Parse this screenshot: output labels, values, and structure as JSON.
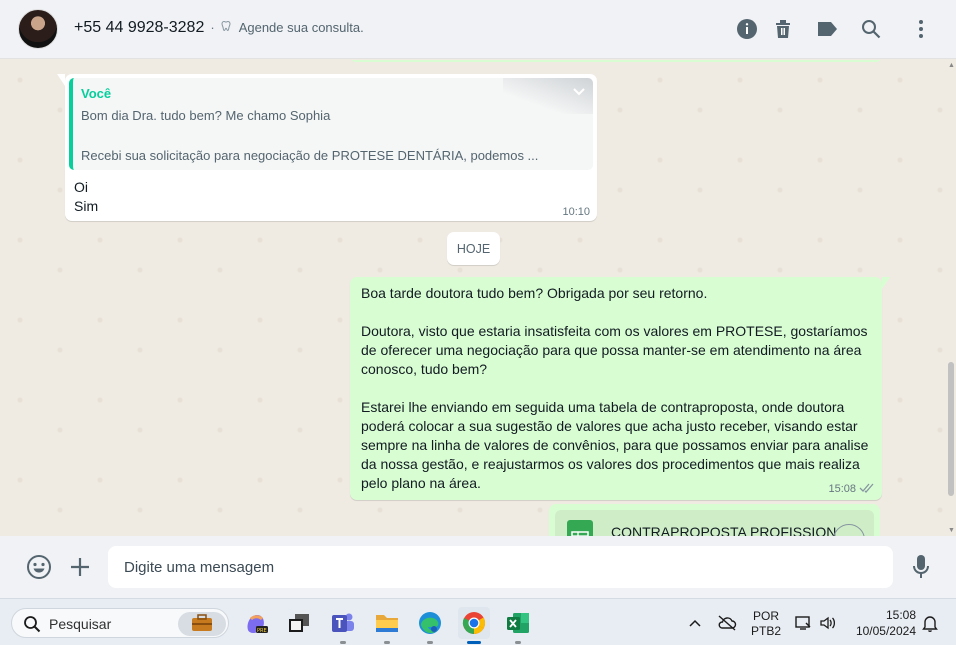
{
  "header": {
    "contact_name": "+55 44 9928-3282",
    "separator": "·",
    "status": "Agende sua consulta.",
    "icons": [
      "info-icon",
      "delete-icon",
      "label-icon",
      "search-icon",
      "menu-icon"
    ]
  },
  "chat": {
    "incoming": {
      "quote_author": "Você",
      "quote_line1": "Bom dia Dra. tudo bem? Me chamo Sophia",
      "quote_line2": "Recebi sua solicitação para negociação de PROTESE DENTÁRIA, podemos ...",
      "line1": "Oi",
      "line2": "Sim",
      "time": "10:10"
    },
    "day_divider": "HOJE",
    "outgoing": {
      "p1": "Boa tarde doutora tudo bem? Obrigada por seu retorno.",
      "p2": "Doutora, visto que estaria insatisfeita com os valores em PROTESE, gostaríamos de oferecer uma negociação para que possa manter-se em atendimento na área conosco, tudo bem?",
      "p3": "Estarei lhe enviando em seguida uma tabela de contraproposta, onde doutora poderá colocar a sua sugestão de valores que acha justo receber, visando estar sempre na linha de valores de convênios, para que possamos enviar para analise da nossa gestão, e reajustarmos os valores dos procedimentos que mais realiza pelo plano na área.",
      "time": "15:08",
      "status": "read"
    },
    "document": {
      "name": "CONTRAPROPOSTA PROFISSION"
    }
  },
  "composer": {
    "placeholder": "Digite uma mensagem"
  },
  "taskbar": {
    "search_label": "Pesquisar",
    "apps": [
      "copilot-icon",
      "task-view-icon",
      "teams-icon",
      "file-explorer-icon",
      "edge-icon",
      "chrome-icon",
      "excel-icon"
    ],
    "lang_line1": "POR",
    "lang_line2": "PTB2",
    "time": "15:08",
    "date": "10/05/2024"
  },
  "colors": {
    "accent_green": "#06cf9c",
    "outgoing_bubble": "#d9fdd3",
    "chat_bg": "#efeae2"
  }
}
